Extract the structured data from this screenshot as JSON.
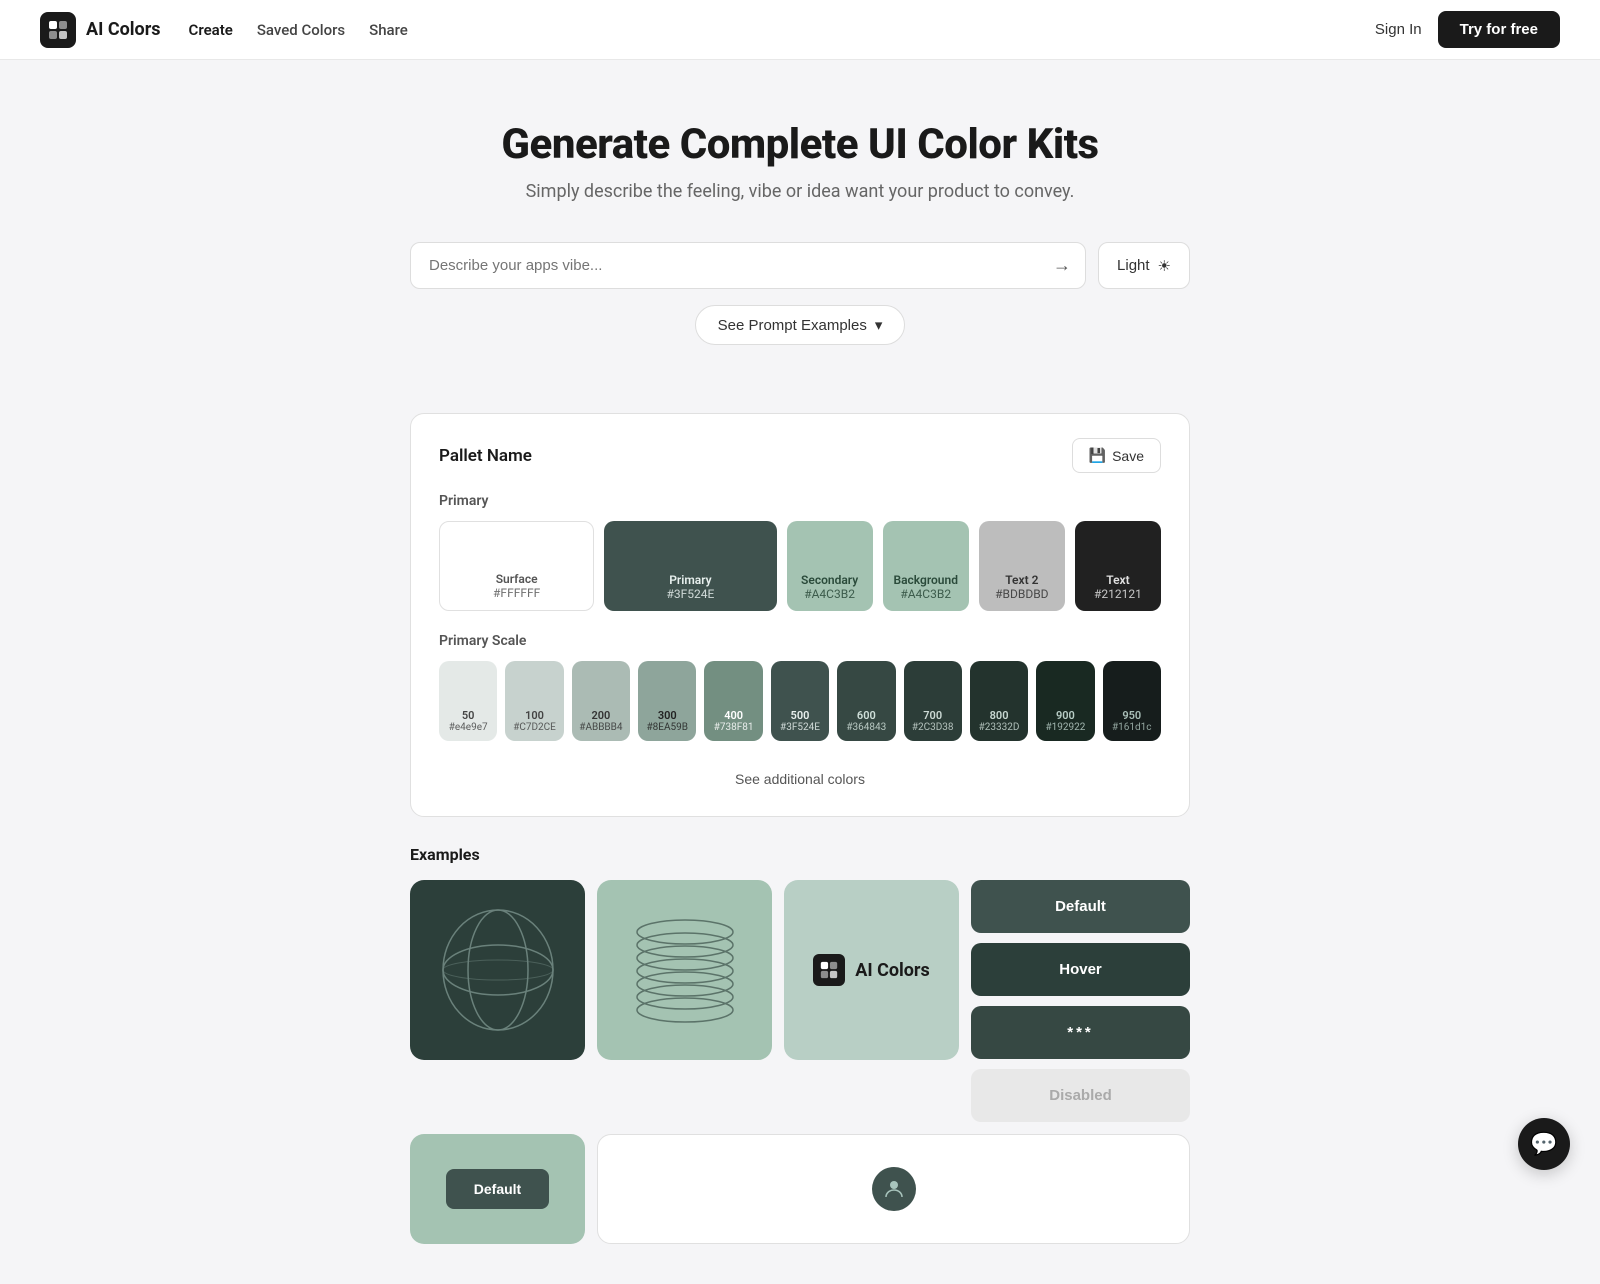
{
  "header": {
    "logo_text": "AI Colors",
    "nav": {
      "create": "Create",
      "saved_colors": "Saved Colors",
      "share": "Share"
    },
    "sign_in": "Sign In",
    "try_free": "Try for free"
  },
  "hero": {
    "title": "Generate Complete UI Color Kits",
    "subtitle": "Simply describe the feeling, vibe or idea want your product to convey."
  },
  "search": {
    "placeholder": "Describe your apps vibe...",
    "submit_arrow": "→",
    "theme_label": "Light",
    "theme_icon": "☀"
  },
  "prompt_examples_btn": "See Prompt Examples",
  "palette": {
    "name": "Pallet Name",
    "save_label": "Save",
    "primary_label": "Primary",
    "swatches": [
      {
        "name": "Surface",
        "hex": "#FFFFFF",
        "display": "#FFFFFF"
      },
      {
        "name": "Primary",
        "hex": "#3F524E",
        "display": "#3F524E"
      },
      {
        "name": "Secondary",
        "hex": "#A4C3B2",
        "display": "#A4C3B2"
      },
      {
        "name": "Background",
        "hex": "#A4C3B2",
        "display": "#A4C3B2"
      },
      {
        "name": "Text 2",
        "hex": "#BDBDBD",
        "display": "#BDBDBD"
      },
      {
        "name": "Text",
        "hex": "#212121",
        "display": "#212121"
      }
    ],
    "scale_label": "Primary Scale",
    "scale": [
      {
        "level": "50",
        "hex": "#e4e9e7",
        "bg": "#e4e9e7",
        "text": "#444"
      },
      {
        "level": "100",
        "hex": "#C7D2CE",
        "bg": "#C7D2CE",
        "text": "#444"
      },
      {
        "level": "200",
        "hex": "#ABBBB4",
        "bg": "#ABBBB4",
        "text": "#333"
      },
      {
        "level": "300",
        "hex": "#8EA59B",
        "bg": "#8EA59B",
        "text": "#222"
      },
      {
        "level": "400",
        "hex": "#738F81",
        "bg": "#738F81",
        "text": "#fff"
      },
      {
        "level": "500",
        "hex": "#3F524E",
        "bg": "#3F524E",
        "text": "#e8f0ee"
      },
      {
        "level": "600",
        "hex": "#364843",
        "bg": "#364843",
        "text": "#d0e0da"
      },
      {
        "level": "700",
        "hex": "#2C3D38",
        "bg": "#2C3D38",
        "text": "#cddad5"
      },
      {
        "level": "800",
        "hex": "#23332D",
        "bg": "#23332D",
        "text": "#c8d8d2"
      },
      {
        "level": "900",
        "hex": "#192922",
        "bg": "#192922",
        "text": "#b8cdc6"
      },
      {
        "level": "950",
        "hex": "#161d1c",
        "bg": "#161d1c",
        "text": "#aabfb8"
      }
    ],
    "see_additional": "See additional colors"
  },
  "examples": {
    "title": "Examples",
    "buttons": {
      "default": "Default",
      "hover": "Hover",
      "password": "***",
      "disabled": "Disabled"
    },
    "bottom_card_default": "Default"
  },
  "chat_icon": "💬"
}
